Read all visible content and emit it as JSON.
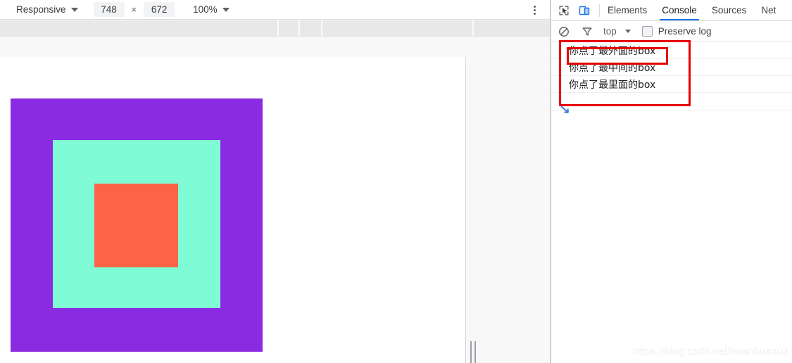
{
  "device_toolbar": {
    "device_preset": "Responsive",
    "width": "748",
    "height": "672",
    "zoom": "100%",
    "menu_icon": "kebab-menu-icon"
  },
  "viewport": {
    "boxes": [
      {
        "name": "outer-box",
        "color": "#8a2be2"
      },
      {
        "name": "middle-box",
        "color": "#7ffcd5"
      },
      {
        "name": "inner-box",
        "color": "#fd6347"
      }
    ],
    "resizer_icon": "viewport-resize-handle-icon"
  },
  "devtools": {
    "icons": {
      "inspect": "inspect-element-icon",
      "device": "toggle-device-toolbar-icon",
      "clear": "clear-console-icon",
      "filter": "filter-funnel-icon"
    },
    "tabs": [
      {
        "label": "Elements",
        "active": false
      },
      {
        "label": "Console",
        "active": true
      },
      {
        "label": "Sources",
        "active": false
      },
      {
        "label": "Net",
        "active": false
      }
    ],
    "filter_bar": {
      "context": "top",
      "preserve_log": "Preserve log",
      "preserve_log_checked": false
    },
    "console_messages": [
      "你点了最外面的box",
      "你点了最中间的box",
      "你点了最里面的box"
    ]
  },
  "annotations": {
    "outer_rect_color": "#e60000",
    "inner_rect_color": "#e60000",
    "arrow_color": "#3b7ddd"
  },
  "watermark": "https://blog.csdn.net/huanhuan03"
}
